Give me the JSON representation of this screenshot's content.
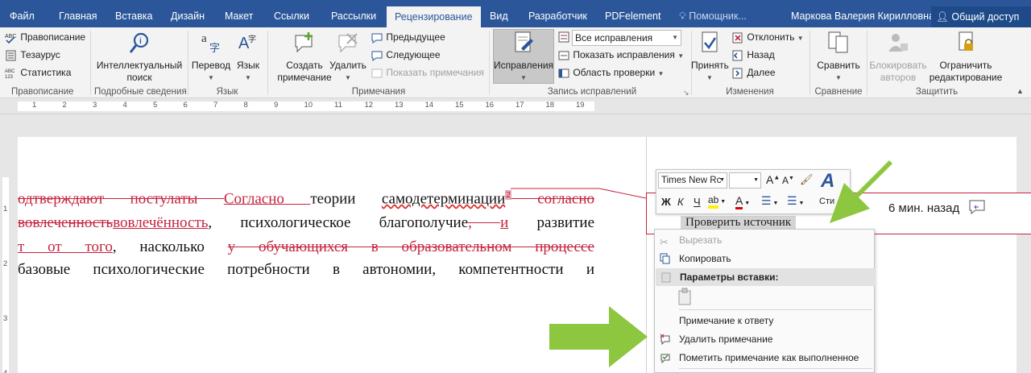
{
  "tabs": [
    "Файл",
    "Главная",
    "Вставка",
    "Дизайн",
    "Макет",
    "Ссылки",
    "Рассылки",
    "Рецензирование",
    "Вид",
    "Разработчик",
    "PDFelement"
  ],
  "tell_me": "Помощник...",
  "user_name": "Маркова Валерия Кирилловна",
  "share_label": "Общий доступ",
  "ribbon": {
    "proofing": {
      "spelling": "Правописание",
      "thesaurus": "Тезаурус",
      "stats": "Статистика",
      "label": "Правописание"
    },
    "insights": {
      "smart_lookup": "Интеллектуальный поиск",
      "label": "Подробные сведения"
    },
    "language": {
      "translate": "Перевод",
      "language": "Язык",
      "label": "Язык"
    },
    "comments": {
      "new": "Создать примечание",
      "delete": "Удалить",
      "prev": "Предыдущее",
      "next": "Следующее",
      "show": "Показать примечания",
      "label": "Примечания"
    },
    "tracking": {
      "track": "Исправления",
      "all_markup": "Все исправления",
      "show_markup": "Показать исправления",
      "pane": "Область проверки",
      "label": "Запись исправлений"
    },
    "changes": {
      "accept": "Принять",
      "reject": "Отклонить",
      "back": "Назад",
      "forward": "Далее",
      "label": "Изменения"
    },
    "compare": {
      "compare": "Сравнить",
      "label": "Сравнение"
    },
    "protect": {
      "block": "Блокировать авторов",
      "restrict": "Ограничить редактирование",
      "label": "Защитить"
    }
  },
  "ruler_numbers": [
    "1",
    "2",
    "3",
    "4",
    "5",
    "6",
    "7",
    "8",
    "9",
    "10",
    "11",
    "12",
    "13",
    "14",
    "15",
    "16",
    "17",
    "18",
    "19"
  ],
  "vruler_numbers": [
    "1",
    "2",
    "3",
    "4"
  ],
  "doc": {
    "l1": {
      "del1": "одтверждают постулаты ",
      "ins1": "Согласно ",
      "t1": "теории ",
      "t2": "самодетерминации",
      "cnum": "2",
      "del2": " согласно"
    },
    "l2": {
      "del1": " вовлеченность",
      "ins1": "вовлечённость",
      "t1": ", психологическое благополучие",
      "del2": ", ",
      "ins2": "и",
      "t2": " развитие"
    },
    "l3": {
      "ins1": "т от того",
      "t1": ", насколько ",
      "del1": "у обучающихся в образовательном процессе"
    },
    "l4": {
      "t1": "базовые психологические потребности в автономии, компетентности и"
    }
  },
  "balloon": {
    "time": "6 мин. назад",
    "check_source": "Проверить источник"
  },
  "mini_toolbar": {
    "font": "Times New Rc",
    "size": "",
    "bold": "Ж",
    "italic": "К",
    "underline": "Ч",
    "styles": "Сти"
  },
  "context_menu": {
    "cut": "Вырезать",
    "copy": "Копировать",
    "paste_options": "Параметры вставки:",
    "reply": "Примечание к ответу",
    "delete_comment": "Удалить примечание",
    "mark_done": "Пометить примечание как выполненное"
  },
  "colors": {
    "ribbon_blue": "#2b579a",
    "revision_red": "#c4243f",
    "arrow_green": "#8dc63f"
  }
}
